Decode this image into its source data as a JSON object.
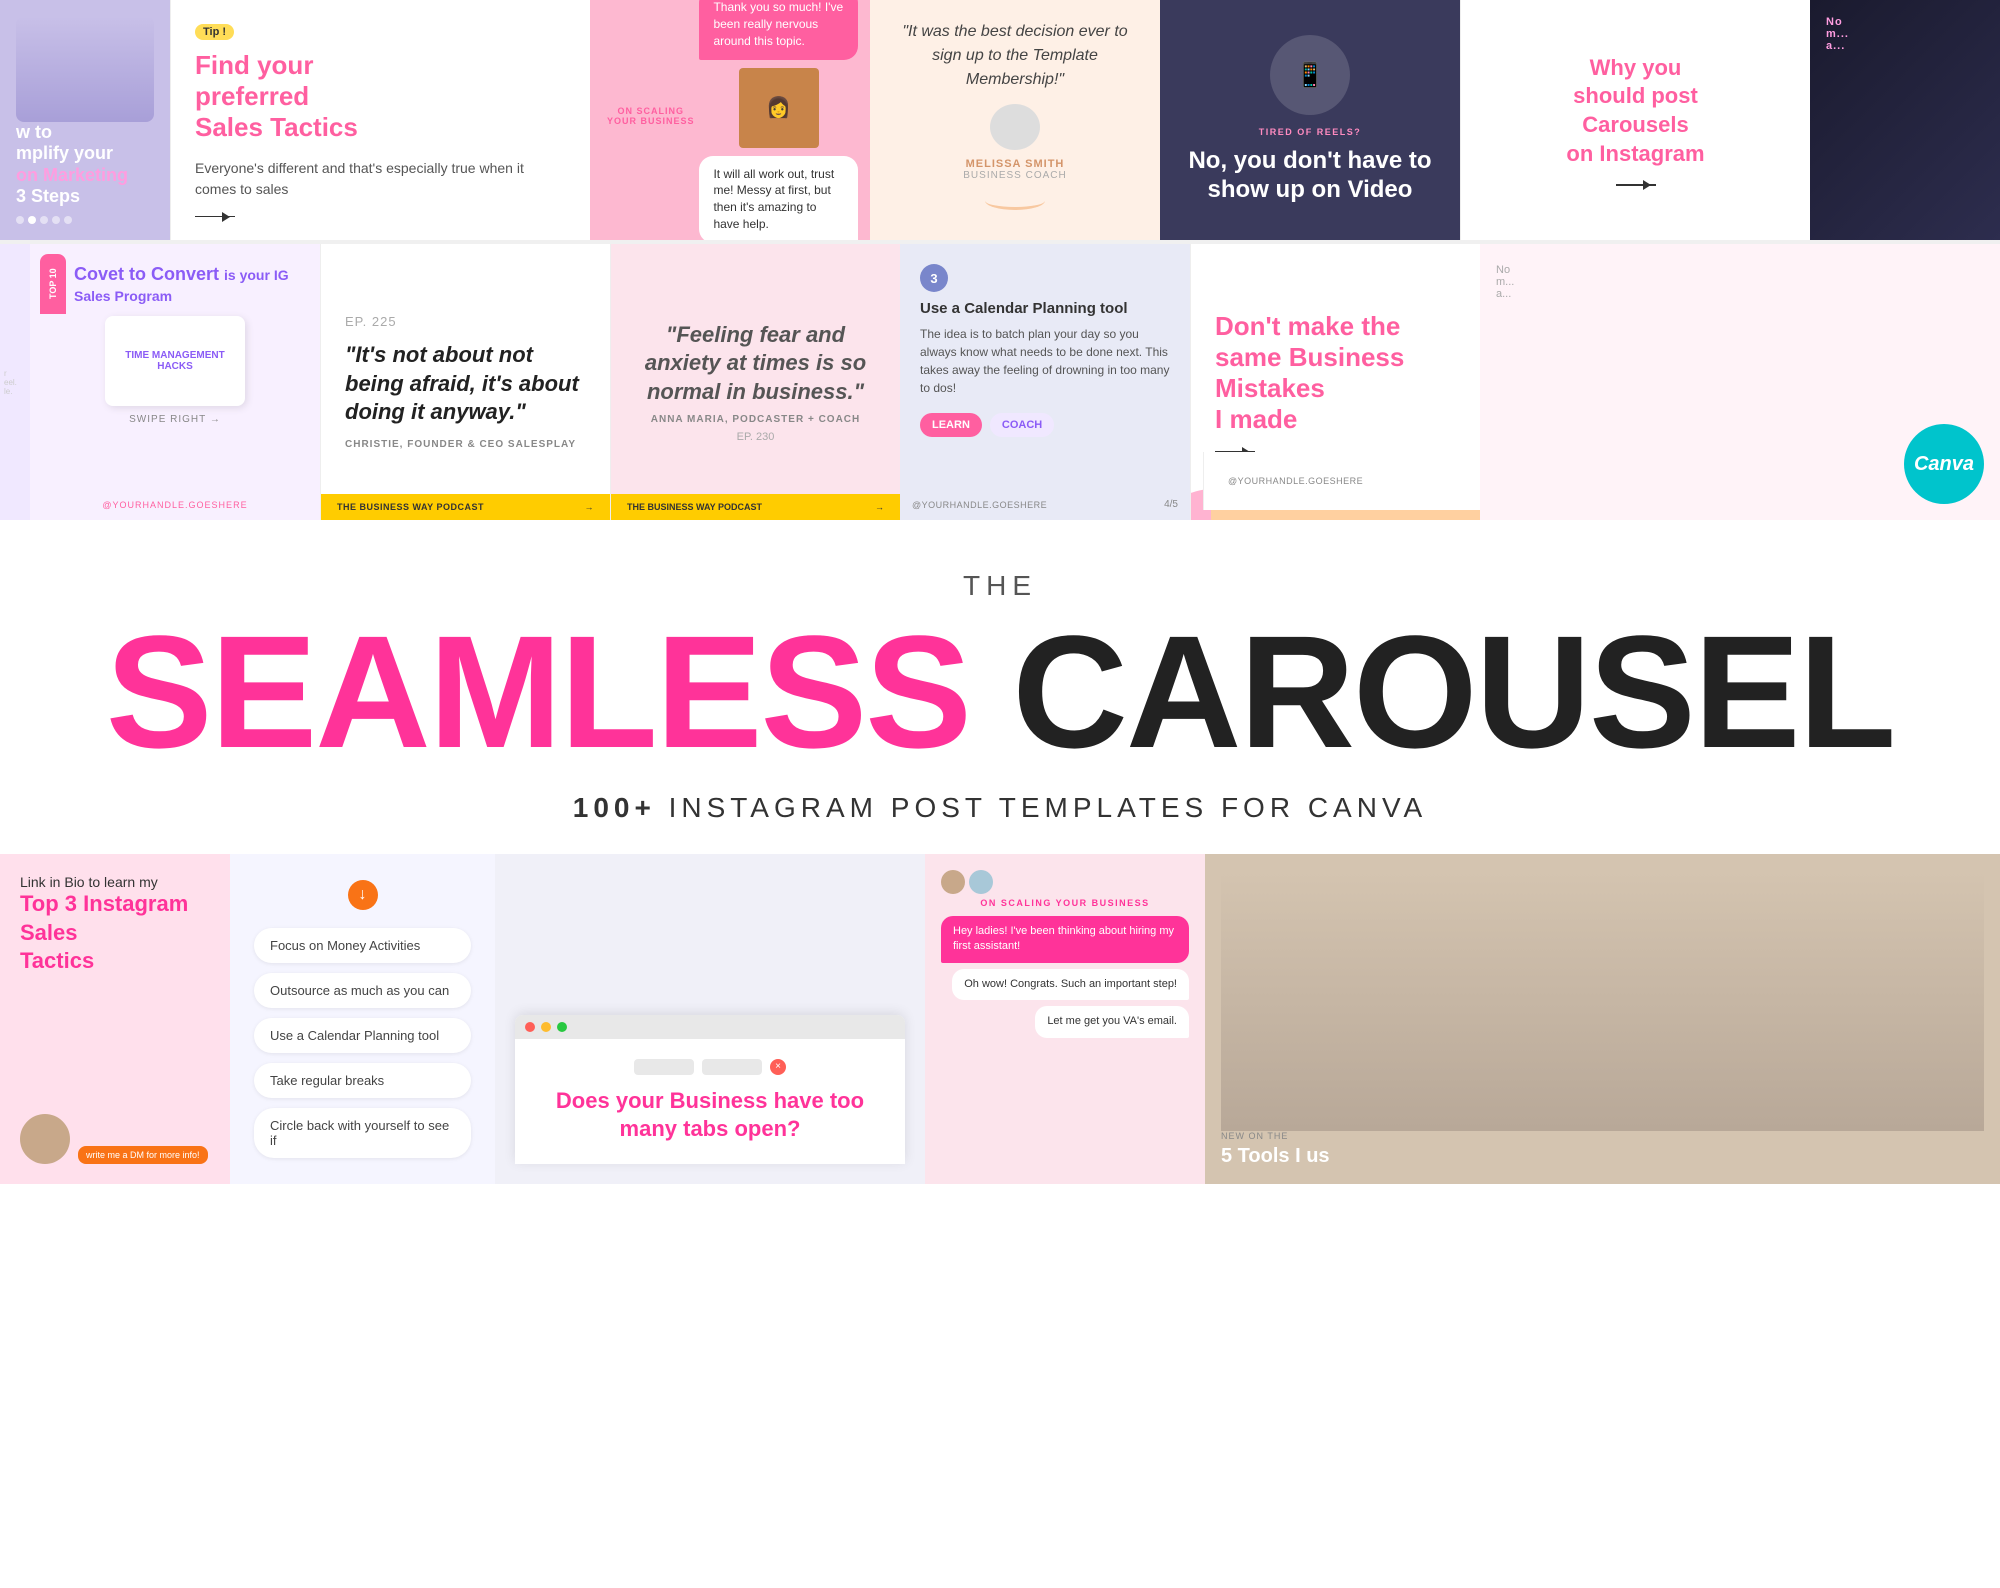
{
  "top_row": {
    "card1": {
      "title_line1": "w to",
      "title_line2": "mplify your",
      "pink_text": "on Marketing",
      "title_line3": "3 Steps",
      "dots": [
        false,
        true,
        false,
        false,
        false
      ]
    },
    "card2": {
      "tip_badge": "Tip !",
      "heading_black1": "Find your",
      "heading_black2": "preferred",
      "heading_pink": "Sales Tactics",
      "body_text": "Everyone's different and that's especially true when it comes to sales"
    },
    "card3": {
      "on_scaling_label": "ON SCALING YOUR BUSINESS",
      "bubble1": "Thank you so much! I've been really nervous around this topic.",
      "bubble2": "It will all work out, trust me! Messy at first, but then it's amazing to have help."
    },
    "card4": {
      "quote": "\"It was the best decision ever to sign up to the Template Membership!\"",
      "person_name": "MELISSA SMITH",
      "person_title": "BUSINESS COACH"
    },
    "card5": {
      "tired_label": "TIRED OF REELS?",
      "heading": "No, you don't have to show up on Video"
    },
    "card6": {
      "heading1": "Why you",
      "heading2": "should post",
      "pink_text": "Carousels",
      "heading3": "on Instagram"
    }
  },
  "mid_row": {
    "card1": {
      "tag": "TOP 10",
      "heading_black": "Covet to Convert",
      "heading_sub": "is your IG Sales Program",
      "device_text": "TIME MANAGEMENT HACKS",
      "swipe": "SWIPE RIGHT",
      "handle": "@YOURHANDLE.GOESHERE"
    },
    "card2": {
      "ep_label": "EP. 225",
      "quote": "\"It's not about not being afraid, it's about doing it anyway.\"",
      "author": "CHRISTIE, FOUNDER & CEO SALESPLAY",
      "footer_label": "THE BUSINESS WAY PODCAST"
    },
    "card3": {
      "quote": "\"Feeling fear and anxiety at times is so normal in business.\"",
      "author": "ANNA MARIA, PODCASTER + COACH",
      "ep_label": "EP. 230",
      "footer_label": "THE BUSINESS WAY PODCAST"
    },
    "card4": {
      "step": "3",
      "heading": "Use a Calendar Planning tool",
      "body": "The idea is to batch plan your day so you always know what needs to be done next. This takes away the feeling of drowning in too many to dos!",
      "page": "4/5",
      "handle": "@YOURHANDLE.GOESHERE"
    },
    "card5": {
      "heading_black1": "Don't make the",
      "heading_black2": "same",
      "pink_text": "Business Mistakes",
      "heading_black3": "I made",
      "handle": "@YOURHANDLE.GOESHERE"
    },
    "canva": {
      "label": "Canva"
    }
  },
  "title_section": {
    "the_label": "THE",
    "pink_word": "SEAMLESS",
    "dark_word": "CAROUSEL",
    "subtitle_count": "100+",
    "subtitle_rest": "INSTAGRAM POST TEMPLATES FOR CANVA"
  },
  "bottom_row": {
    "card1": {
      "link_in_bio": "Link in Bio to learn my",
      "pink_text": "Top 3 Instagram Sales",
      "tactics": "Tactics"
    },
    "card2": {
      "items": [
        "Focus on Money Activities",
        "Outsource as much as you can",
        "Use a Calendar Planning tool",
        "Take regular breaks",
        "Circle back with yourself to see if"
      ]
    },
    "card3": {
      "window_heading_black1": "Does your",
      "window_pink": "Business",
      "window_heading_black2": "have too many tabs open?"
    },
    "card4": {
      "on_scaling": "ON SCALING YOUR BUSINESS",
      "msg1": "Hey ladies! I've been thinking about hiring my first assistant!",
      "msg2": "Oh wow! Congrats. Such an important step!",
      "msg3": "Let me get you VA's email.",
      "new_on": "NEW ON THE",
      "tools_label": "5 Tools I us"
    },
    "card5": {
      "new_on": "NEW ON THE",
      "tools": "5 Tools I us"
    }
  }
}
